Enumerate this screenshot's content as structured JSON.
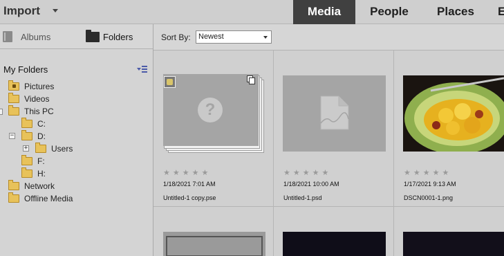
{
  "topbar": {
    "import_label": "Import",
    "tabs": [
      "Media",
      "People",
      "Places",
      "E"
    ]
  },
  "sidebar": {
    "albums_label": "Albums",
    "folders_label": "Folders",
    "my_folders_title": "My Folders",
    "tree": [
      {
        "label": "Pictures"
      },
      {
        "label": "Videos"
      },
      {
        "label": "This PC"
      },
      {
        "label": "C:"
      },
      {
        "label": "D:"
      },
      {
        "label": "Users"
      },
      {
        "label": "F:"
      },
      {
        "label": "H:"
      },
      {
        "label": "Network"
      },
      {
        "label": "Offline Media"
      }
    ]
  },
  "main": {
    "sort_label": "Sort By:",
    "sort_value": "Newest",
    "items": [
      {
        "date": "1/18/2021 7:01 AM",
        "filename": "Untitled-1 copy.pse",
        "rating": 0
      },
      {
        "date": "1/18/2021 10:00 AM",
        "filename": "Untitled-1.psd",
        "rating": 0
      },
      {
        "date": "1/17/2021 9:13 AM",
        "filename": "DSCN0001-1.png",
        "rating": 0
      }
    ],
    "star_glyphs": "★★★★★"
  },
  "colors": {
    "active_tab_bg": "#404040",
    "folder_yellow": "#e8c25a",
    "thumb_gray": "#a5a5a5"
  }
}
